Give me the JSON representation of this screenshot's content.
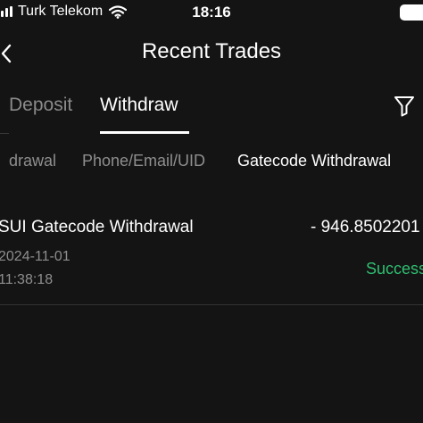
{
  "status_bar": {
    "carrier": "Turk Telekom",
    "time": "18:16",
    "signal_icon": "signal-bars-icon",
    "wifi_icon": "wifi-icon",
    "battery_icon": "battery-icon"
  },
  "nav": {
    "back_icon": "chevron-left-icon",
    "title": "Recent Trades"
  },
  "main_tabs": {
    "items": [
      {
        "label": "Deposit",
        "active": false
      },
      {
        "label": "Withdraw",
        "active": true
      }
    ],
    "filter_icon": "filter-funnel-icon"
  },
  "sub_tabs": {
    "items": [
      {
        "label": "drawal",
        "active": false
      },
      {
        "label": "Phone/Email/UID",
        "active": false
      },
      {
        "label": "Gatecode Withdrawal",
        "active": true
      }
    ]
  },
  "trades": [
    {
      "name": "SUI Gatecode Withdrawal",
      "amount": "- 946.8502201",
      "date": "2024-11-01",
      "time": "11:38:18",
      "status": "Success"
    }
  ],
  "colors": {
    "background": "#141414",
    "text_primary": "#ffffff",
    "text_secondary": "#8e8e8e",
    "success": "#2fbf71",
    "divider": "#333333"
  }
}
